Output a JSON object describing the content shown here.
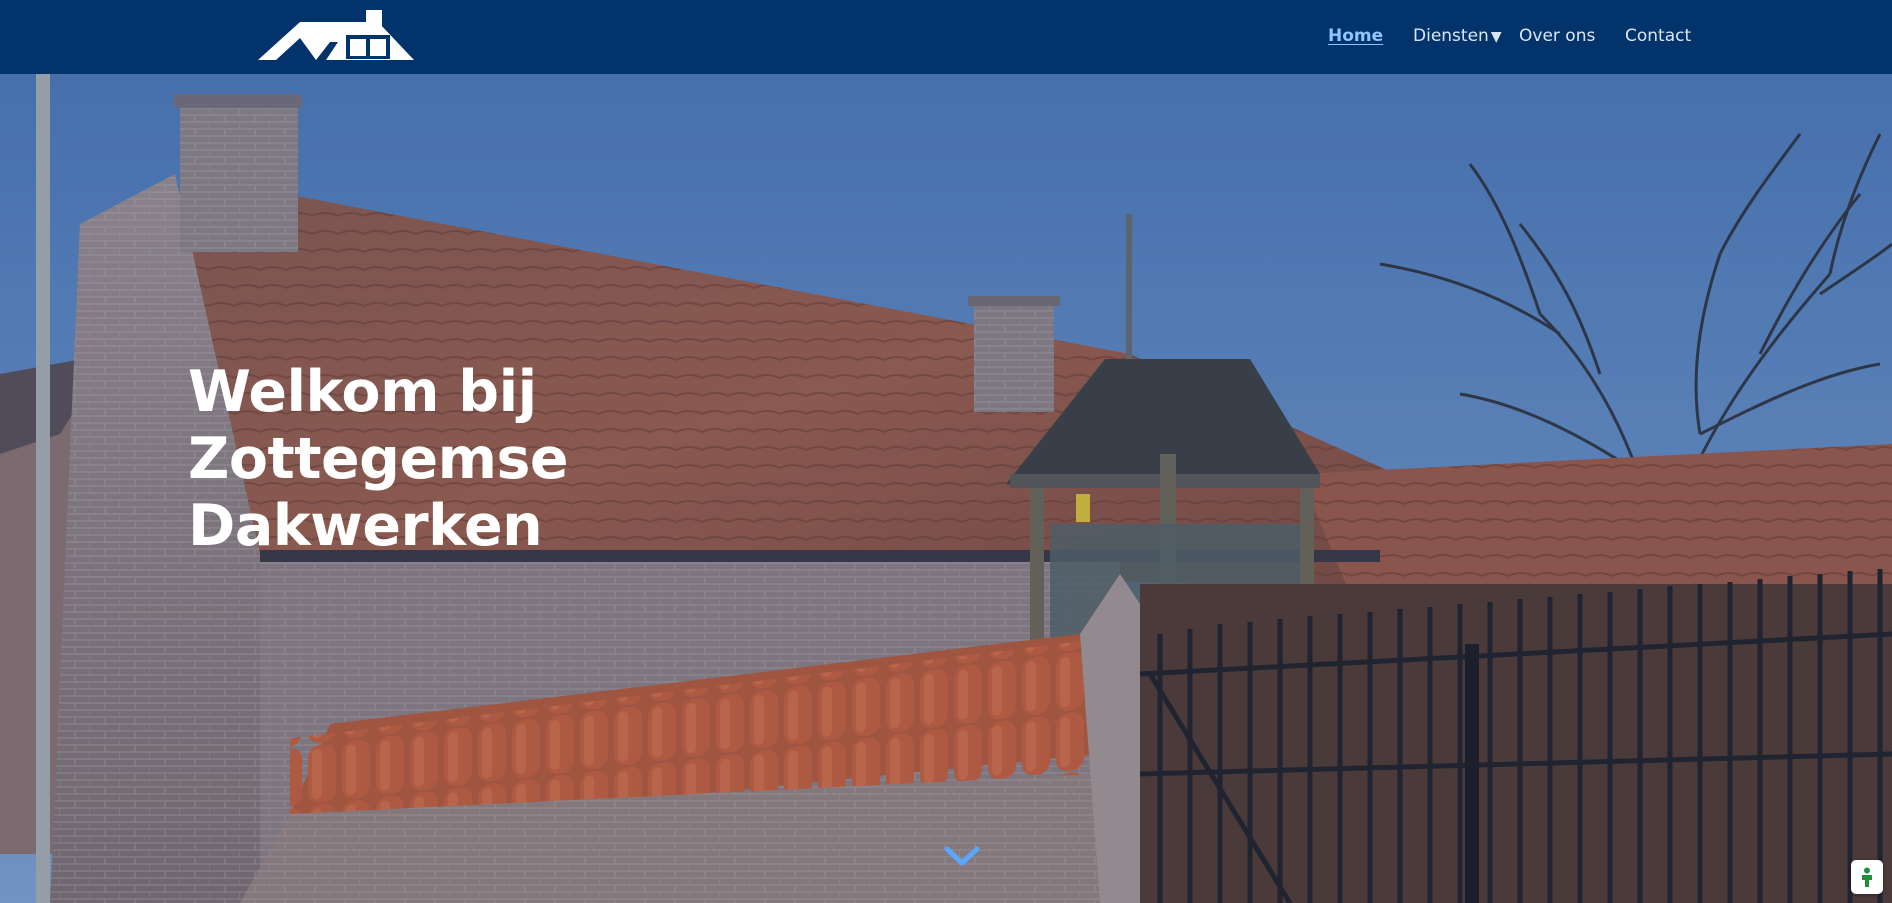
{
  "header": {
    "logo_icon": "house-roof-logo-icon",
    "nav": {
      "home": "Home",
      "diensten": "Diensten",
      "diensten_caret": "▼",
      "over_ons": "Over ons",
      "contact": "Contact"
    },
    "active_item": "Home"
  },
  "hero": {
    "title_lines": [
      "Welkom bij",
      "Zottegemse",
      "Dakwerken"
    ],
    "scroll_icon": "chevron-down-icon"
  },
  "widgets": {
    "cookie_icon": "privacy-person-icon"
  },
  "colors": {
    "header_bg": "#02336a",
    "nav_text": "#dbe6f5",
    "nav_active": "#8fc6ff",
    "hero_title": "#ffffff",
    "accent": "#5aa7ff",
    "cookie_icon": "#1f8f3a"
  }
}
